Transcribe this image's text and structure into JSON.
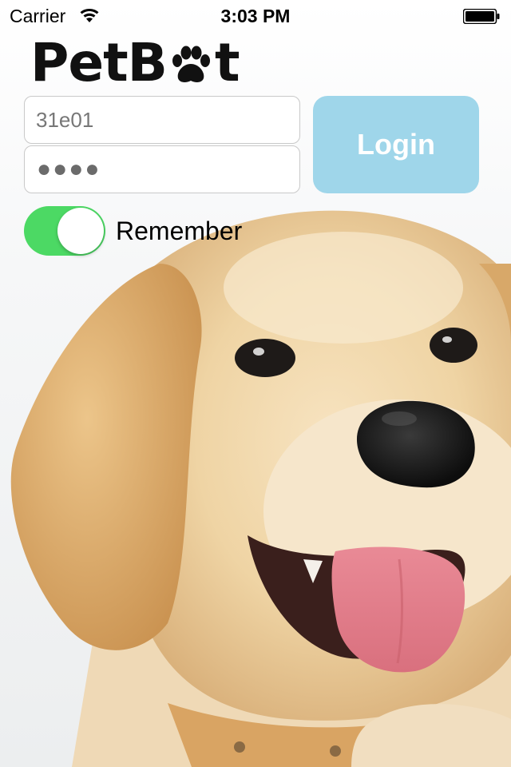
{
  "status_bar": {
    "carrier": "Carrier",
    "time": "3:03 PM",
    "icons": [
      "wifi-icon",
      "battery-icon"
    ]
  },
  "logo": {
    "text_before": "PetB",
    "text_after": "t",
    "icon": "paw-icon"
  },
  "login_form": {
    "username_value": "31e01",
    "password_mask": "●●●●",
    "login_label": "Login",
    "remember_label": "Remember",
    "remember_on": true
  },
  "background": {
    "subject": "golden-retriever-puppy"
  },
  "colors": {
    "login_button": "#9fd6ea",
    "toggle_on": "#4cd964",
    "logo": "#111111"
  }
}
